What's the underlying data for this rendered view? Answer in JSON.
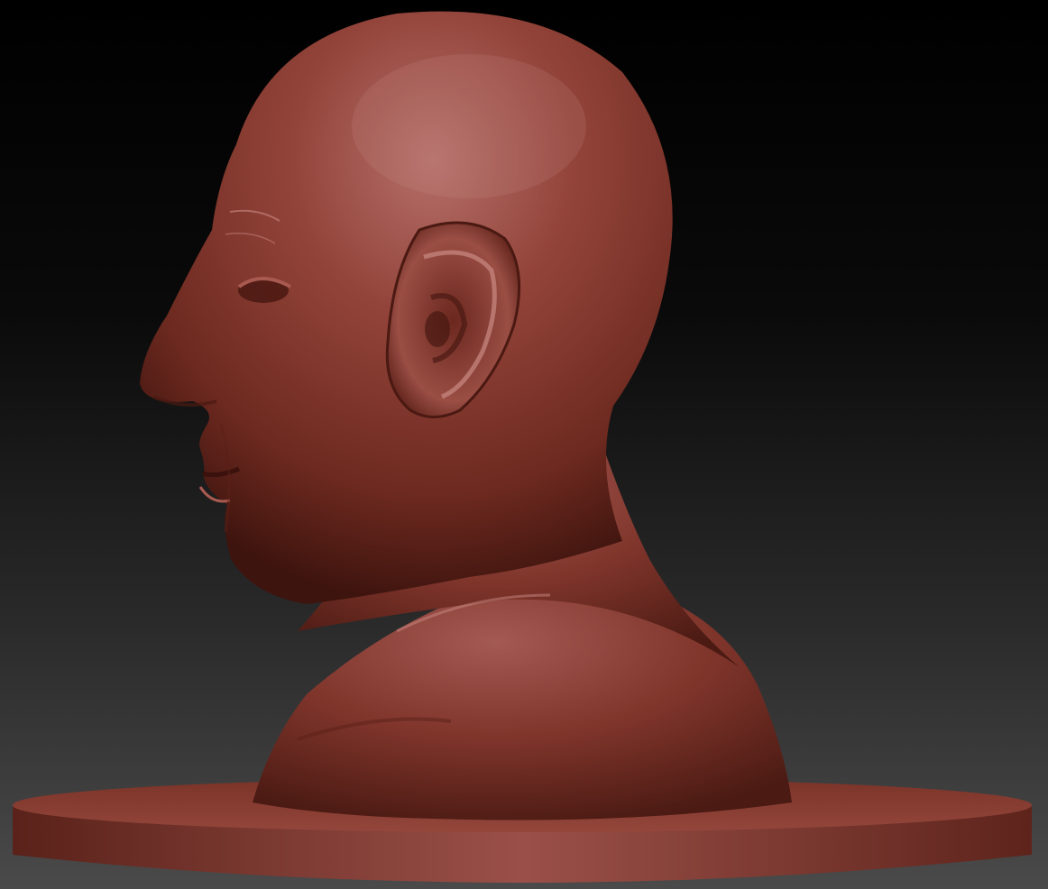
{
  "viewport": {
    "subject": "sculpted-head-bust",
    "material_color": "#8a3b2e",
    "material_highlight": "#b86a62",
    "material_shadow": "#3e140e",
    "background_top": "#000000",
    "background_bottom": "#4a4a4a"
  }
}
